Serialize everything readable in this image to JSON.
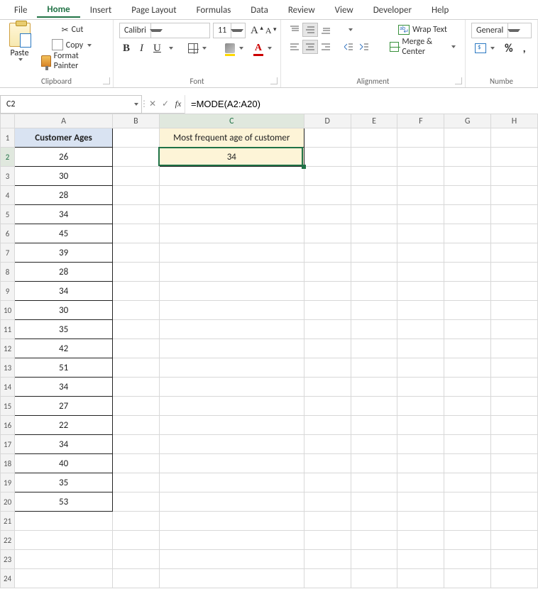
{
  "tabs": [
    "File",
    "Home",
    "Insert",
    "Page Layout",
    "Formulas",
    "Data",
    "Review",
    "View",
    "Developer",
    "Help"
  ],
  "active_tab_index": 1,
  "clipboard": {
    "paste": "Paste",
    "cut": "Cut",
    "copy": "Copy",
    "format_painter": "Format Painter",
    "group_label": "Clipboard"
  },
  "font": {
    "name": "Calibri",
    "size": "11",
    "bold": "B",
    "italic": "I",
    "underline": "U",
    "fontcolor_glyph": "A",
    "bigA": "A",
    "smallA": "A",
    "group_label": "Font"
  },
  "alignment": {
    "wrap": "Wrap Text",
    "merge": "Merge & Center",
    "group_label": "Alignment"
  },
  "number": {
    "format": "General",
    "pct": "%",
    "comma": ",",
    "group_label": "Numbe"
  },
  "namebox": "C2",
  "fx_label": "fx",
  "formula": "=MODE(A2:A20)",
  "columns": [
    "A",
    "B",
    "C",
    "D",
    "E",
    "F",
    "G",
    "H"
  ],
  "row_count": 24,
  "headerA": "Customer Ages",
  "colA_values": [
    "26",
    "30",
    "28",
    "34",
    "45",
    "39",
    "28",
    "34",
    "30",
    "35",
    "42",
    "51",
    "34",
    "27",
    "22",
    "34",
    "40",
    "35",
    "53"
  ],
  "C1": "Most frequent age of customer",
  "C2": "34",
  "selected_cell": "C2"
}
